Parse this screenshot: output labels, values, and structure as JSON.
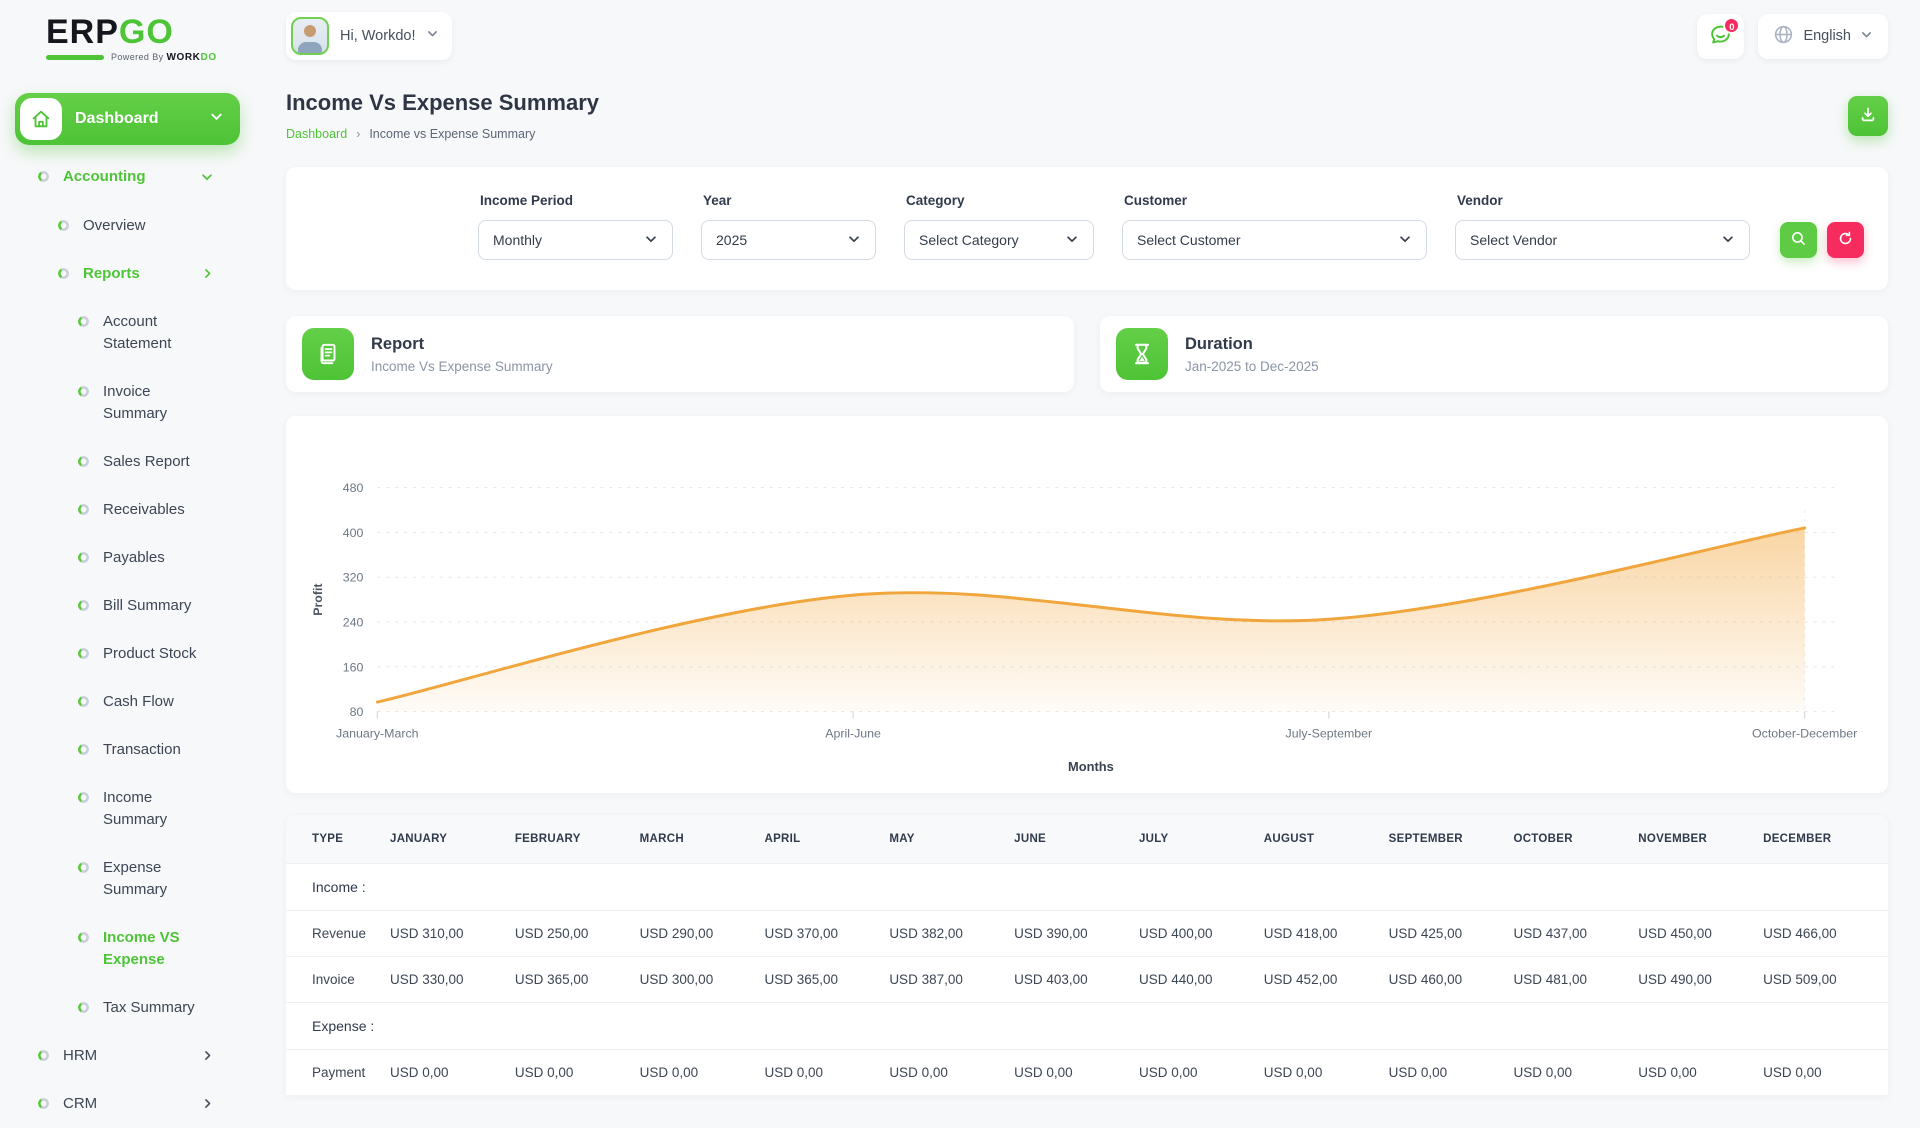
{
  "brand": {
    "part1": "ERP",
    "part2": "GO",
    "powered_by": "Powered By",
    "workdo_1": "WORK",
    "workdo_2": "DO"
  },
  "topbar": {
    "greeting": "Hi, Workdo!",
    "notification_count": "0",
    "language": "English"
  },
  "sidebar": {
    "dashboard_label": "Dashboard",
    "items": [
      {
        "label": "Accounting",
        "level": 1,
        "active": true,
        "chevron": "down"
      },
      {
        "label": "Overview",
        "level": 2
      },
      {
        "label": "Reports",
        "level": 2,
        "active": true,
        "chevron": "right"
      },
      {
        "label": "Account Statement",
        "level": 3,
        "wrap": true
      },
      {
        "label": "Invoice Summary",
        "level": 3
      },
      {
        "label": "Sales Report",
        "level": 3
      },
      {
        "label": "Receivables",
        "level": 3
      },
      {
        "label": "Payables",
        "level": 3
      },
      {
        "label": "Bill Summary",
        "level": 3
      },
      {
        "label": "Product Stock",
        "level": 3
      },
      {
        "label": "Cash Flow",
        "level": 3
      },
      {
        "label": "Transaction",
        "level": 3
      },
      {
        "label": "Income Summary",
        "level": 3
      },
      {
        "label": "Expense Summary",
        "level": 3,
        "wrap": true
      },
      {
        "label": "Income VS Expense",
        "level": 3,
        "active": true,
        "wrap": true
      },
      {
        "label": "Tax Summary",
        "level": 3
      },
      {
        "label": "HRM",
        "level": 1,
        "chevron": "right"
      },
      {
        "label": "CRM",
        "level": 1,
        "chevron": "right"
      }
    ]
  },
  "page": {
    "title": "Income Vs Expense Summary",
    "breadcrumb_root": "Dashboard",
    "breadcrumb_separator": "›",
    "breadcrumb_current": "Income vs Expense Summary"
  },
  "filters": {
    "fields": [
      {
        "label": "Income Period",
        "value": "Monthly"
      },
      {
        "label": "Year",
        "value": "2025"
      },
      {
        "label": "Category",
        "value": "Select Category"
      },
      {
        "label": "Customer",
        "value": "Select Customer"
      },
      {
        "label": "Vendor",
        "value": "Select Vendor"
      }
    ]
  },
  "cards": {
    "report": {
      "title": "Report",
      "subtitle": "Income Vs Expense Summary"
    },
    "duration": {
      "title": "Duration",
      "subtitle": "Jan-2025 to Dec-2025"
    }
  },
  "chart_data": {
    "type": "area",
    "x": [
      "January-March",
      "April-June",
      "July-September",
      "October-December"
    ],
    "series": [
      {
        "name": "Profit",
        "values": [
          97,
          288,
          245,
          408
        ]
      }
    ],
    "xlabel": "Months",
    "ylabel": "Profit",
    "ylim": [
      80,
      480
    ],
    "yticks": [
      80,
      160,
      240,
      320,
      400,
      480
    ],
    "grid": "dashed-horizontal",
    "smooth": true,
    "line_color": "#f0a63c",
    "fill": "orange-gradient"
  },
  "table": {
    "headers": [
      "TYPE",
      "JANUARY",
      "FEBRUARY",
      "MARCH",
      "APRIL",
      "MAY",
      "JUNE",
      "JULY",
      "AUGUST",
      "SEPTEMBER",
      "OCTOBER",
      "NOVEMBER",
      "DECEMBER"
    ],
    "sections": [
      {
        "label": "Income :",
        "rows": [
          {
            "type": "Revenue",
            "values": [
              "USD 310,00",
              "USD 250,00",
              "USD 290,00",
              "USD 370,00",
              "USD 382,00",
              "USD 390,00",
              "USD 400,00",
              "USD 418,00",
              "USD 425,00",
              "USD 437,00",
              "USD 450,00",
              "USD 466,00"
            ]
          },
          {
            "type": "Invoice",
            "values": [
              "USD 330,00",
              "USD 365,00",
              "USD 300,00",
              "USD 365,00",
              "USD 387,00",
              "USD 403,00",
              "USD 440,00",
              "USD 452,00",
              "USD 460,00",
              "USD 481,00",
              "USD 490,00",
              "USD 509,00"
            ]
          }
        ]
      },
      {
        "label": "Expense :",
        "rows": [
          {
            "type": "Payment",
            "values": [
              "USD 0,00",
              "USD 0,00",
              "USD 0,00",
              "USD 0,00",
              "USD 0,00",
              "USD 0,00",
              "USD 0,00",
              "USD 0,00",
              "USD 0,00",
              "USD 0,00",
              "USD 0,00",
              "USD 0,00"
            ]
          }
        ]
      }
    ]
  },
  "colors": {
    "accent_green": "#4ec536",
    "pink": "#f62b5e",
    "chart_line": "#f0a63c"
  }
}
